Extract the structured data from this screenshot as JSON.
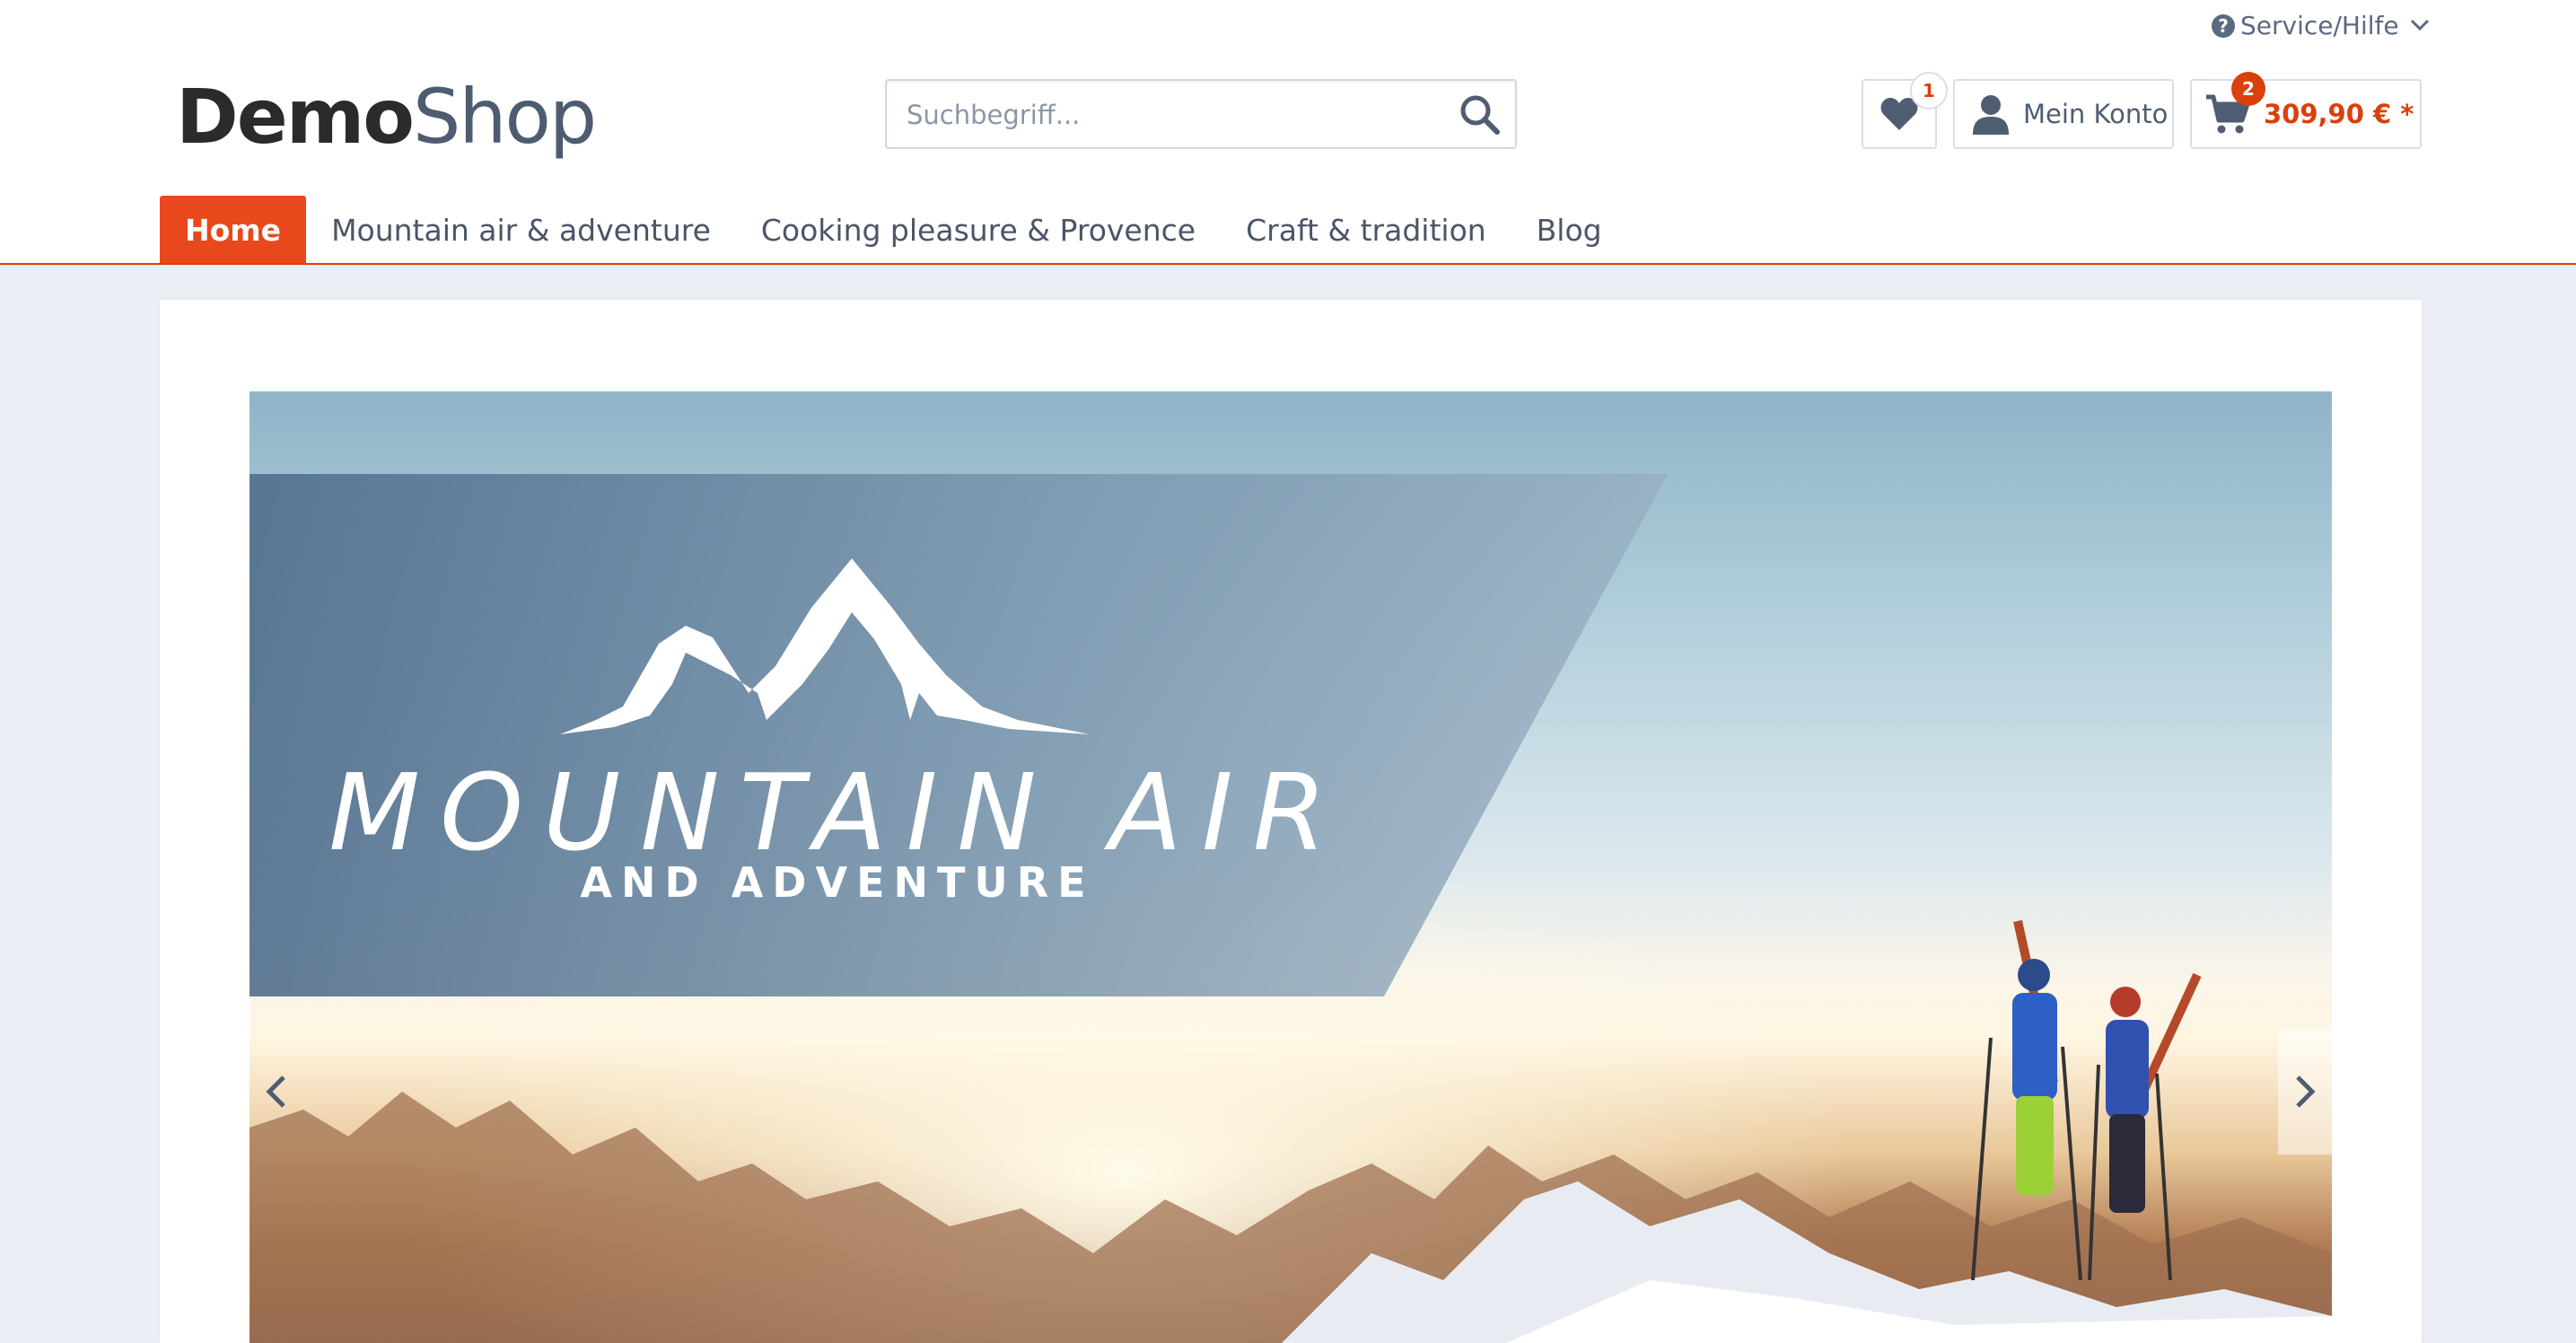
{
  "top": {
    "service_label": "Service/Hilfe"
  },
  "logo": {
    "part1": "Demo",
    "part2": "Shop"
  },
  "search": {
    "placeholder": "Suchbegriff..."
  },
  "header": {
    "wishlist_count": "1",
    "account_label": "Mein Konto",
    "cart_count": "2",
    "cart_amount": "309,90 € *"
  },
  "nav": {
    "items": [
      {
        "label": "Home"
      },
      {
        "label": "Mountain air & adventure"
      },
      {
        "label": "Cooking pleasure & Provence"
      },
      {
        "label": "Craft & tradition"
      },
      {
        "label": "Blog"
      }
    ]
  },
  "slider": {
    "title": "MOUNTAIN AIR",
    "subtitle": "AND ADVENTURE"
  },
  "colors": {
    "accent": "#e8481b",
    "nav_text": "#4a5568",
    "background": "#eceef5"
  },
  "icons": [
    "help-icon",
    "chevron-down-icon",
    "search-icon",
    "heart-icon",
    "user-icon",
    "cart-icon",
    "mountain-icon",
    "chevron-left-icon",
    "chevron-right-icon"
  ]
}
